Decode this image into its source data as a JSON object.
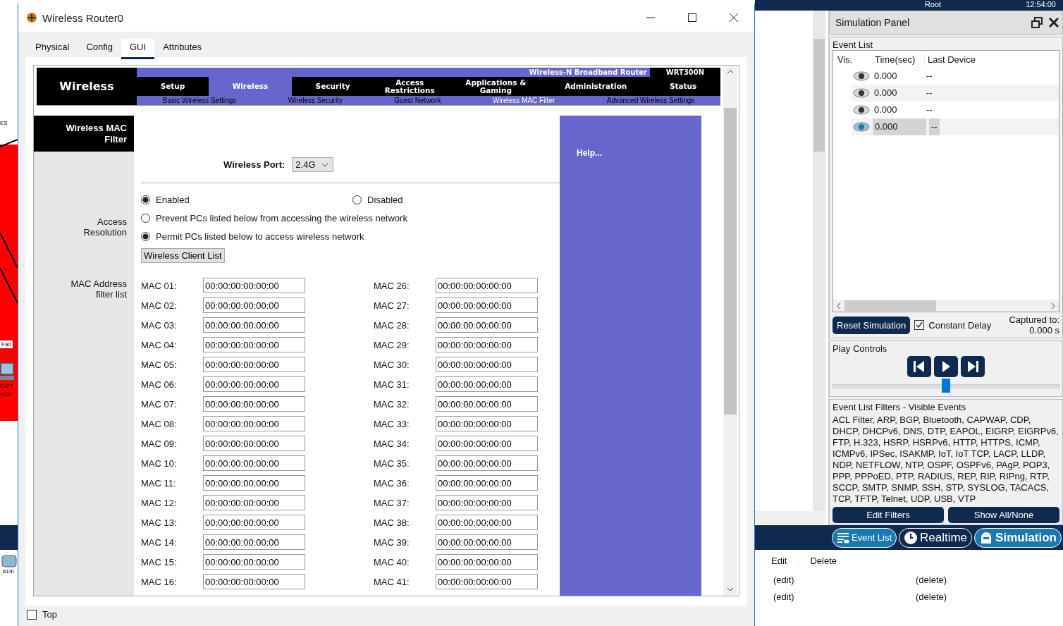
{
  "taskbar": {
    "user": "Root",
    "clock": "12:54:00"
  },
  "workspace": {
    "labels": [
      {
        "text": "ES"
      },
      {
        "text": "Fa0"
      },
      {
        "text": "C-PT"
      },
      {
        "text": "PC3"
      },
      {
        "text": "819I"
      }
    ]
  },
  "router_window": {
    "title": "Wireless Router0",
    "tabs": [
      {
        "label": "Physical",
        "selected": false
      },
      {
        "label": "Config",
        "selected": false
      },
      {
        "label": "GUI",
        "selected": true
      },
      {
        "label": "Attributes",
        "selected": false
      }
    ],
    "page": {
      "section": "Wireless",
      "brand": "Wireless-N Broadband Router",
      "model": "WRT300N",
      "menu": [
        {
          "label": "Setup",
          "selected": false
        },
        {
          "label": "Wireless",
          "selected": true
        },
        {
          "label": "Security",
          "selected": false
        },
        {
          "label": "Access Restrictions",
          "selected": false
        },
        {
          "label": "Applications & Gaming",
          "selected": false
        },
        {
          "label": "Administration",
          "selected": false
        },
        {
          "label": "Status",
          "selected": false
        }
      ],
      "submenu": [
        {
          "label": "Basic Wireless Settings",
          "selected": false
        },
        {
          "label": "Wireless Security",
          "selected": false
        },
        {
          "label": "Guest Network",
          "selected": false
        },
        {
          "label": "Wireless MAC Filter",
          "selected": true
        },
        {
          "label": "Advanced Wireless Settings",
          "selected": false
        }
      ],
      "side_title": "Wireless MAC Filter",
      "help": "Help...",
      "port": {
        "label": "Wireless Port:",
        "value": "2.4G"
      },
      "enable_options": [
        {
          "label": "Enabled",
          "selected": true
        },
        {
          "label": "Disabled",
          "selected": false
        }
      ],
      "access_label": "Access Resolution",
      "access_options": [
        {
          "label": "Prevent PCs listed below from accessing the wireless network",
          "selected": false
        },
        {
          "label": "Permit PCs listed below to access wireless network",
          "selected": true
        }
      ],
      "client_list_button": "Wireless Client List",
      "mac_label": "MAC Address filter list",
      "mac_columns": [
        [
          {
            "label": "MAC 01:",
            "value": "00:00:00:00:00:00"
          },
          {
            "label": "MAC 02:",
            "value": "00:00:00:00:00:00"
          },
          {
            "label": "MAC 03:",
            "value": "00:00:00:00:00:00"
          },
          {
            "label": "MAC 04:",
            "value": "00:00:00:00:00:00"
          },
          {
            "label": "MAC 05:",
            "value": "00:00:00:00:00:00"
          },
          {
            "label": "MAC 06:",
            "value": "00:00:00:00:00:00"
          },
          {
            "label": "MAC 07:",
            "value": "00:00:00:00:00:00"
          },
          {
            "label": "MAC 08:",
            "value": "00:00:00:00:00:00"
          },
          {
            "label": "MAC 09:",
            "value": "00:00:00:00:00:00"
          },
          {
            "label": "MAC 10:",
            "value": "00:00:00:00:00:00"
          },
          {
            "label": "MAC 11:",
            "value": "00:00:00:00:00:00"
          },
          {
            "label": "MAC 12:",
            "value": "00:00:00:00:00:00"
          },
          {
            "label": "MAC 13:",
            "value": "00:00:00:00:00:00"
          },
          {
            "label": "MAC 14:",
            "value": "00:00:00:00:00:00"
          },
          {
            "label": "MAC 15:",
            "value": "00:00:00:00:00:00"
          },
          {
            "label": "MAC 16:",
            "value": "00:00:00:00:00:00"
          }
        ],
        [
          {
            "label": "MAC 26:",
            "value": "00:00:00:00:00:00"
          },
          {
            "label": "MAC 27:",
            "value": "00:00:00:00:00:00"
          },
          {
            "label": "MAC 28:",
            "value": "00:00:00:00:00:00"
          },
          {
            "label": "MAC 29:",
            "value": "00:00:00:00:00:00"
          },
          {
            "label": "MAC 30:",
            "value": "00:00:00:00:00:00"
          },
          {
            "label": "MAC 31:",
            "value": "00:00:00:00:00:00"
          },
          {
            "label": "MAC 32:",
            "value": "00:00:00:00:00:00"
          },
          {
            "label": "MAC 33:",
            "value": "00:00:00:00:00:00"
          },
          {
            "label": "MAC 34:",
            "value": "00:00:00:00:00:00"
          },
          {
            "label": "MAC 35:",
            "value": "00:00:00:00:00:00"
          },
          {
            "label": "MAC 36:",
            "value": "00:00:00:00:00:00"
          },
          {
            "label": "MAC 37:",
            "value": "00:00:00:00:00:00"
          },
          {
            "label": "MAC 38:",
            "value": "00:00:00:00:00:00"
          },
          {
            "label": "MAC 39:",
            "value": "00:00:00:00:00:00"
          },
          {
            "label": "MAC 40:",
            "value": "00:00:00:00:00:00"
          },
          {
            "label": "MAC 41:",
            "value": "00:00:00:00:00:00"
          }
        ]
      ]
    },
    "top_checkbox": {
      "label": "Top",
      "checked": false
    }
  },
  "simulation_panel": {
    "title": "Simulation Panel",
    "event_list_label": "Event List",
    "columns": [
      "Vis.",
      "Time(sec)",
      "Last Device"
    ],
    "events": [
      {
        "time": "0.000",
        "last_device": "--",
        "selected": false
      },
      {
        "time": "0.000",
        "last_device": "--",
        "selected": false
      },
      {
        "time": "0.000",
        "last_device": "--",
        "selected": false
      },
      {
        "time": "0.000",
        "last_device": "--",
        "selected": true
      }
    ],
    "reset_button": "Reset Simulation",
    "constant_delay": {
      "label": "Constant Delay",
      "checked": true
    },
    "captured_label": "Captured to:",
    "captured_value": "0.000 s",
    "play_controls_label": "Play Controls",
    "speed": {
      "level": 0.5
    },
    "filters_title": "Event List Filters - Visible Events",
    "filters_text": "ACL Filter, ARP, BGP, Bluetooth, CAPWAP, CDP, DHCP, DHCPv6, DNS, DTP, EAPOL, EIGRP, EIGRPv6, FTP, H.323, HSRP, HSRPv6, HTTP, HTTPS, ICMP, ICMPv6, IPSec, ISAKMP, IoT, IoT TCP, LACP, LLDP, NDP, NETFLOW, NTP, OSPF, OSPFv6, PAgP, POP3, PPP, PPPoED, PTP, RADIUS, REP, RIP, RIPng, RTP, SCCP, SMTP, SNMP, SSH, STP, SYSLOG, TACACS, TCP, TFTP, Telnet, UDP, USB, VTP",
    "edit_filters_button": "Edit Filters",
    "show_all_button": "Show All/None"
  },
  "mode_bar": [
    {
      "label": "Event List",
      "kind": "list",
      "selected": false
    },
    {
      "label": "Realtime",
      "kind": "realtime",
      "selected": false
    },
    {
      "label": "Simulation",
      "kind": "simulation",
      "selected": true
    }
  ],
  "pdu_table": {
    "columns": [
      "Edit",
      "Delete"
    ],
    "rows": [
      [
        "(edit)",
        "(delete)"
      ],
      [
        "(edit)",
        "(delete)"
      ]
    ]
  }
}
